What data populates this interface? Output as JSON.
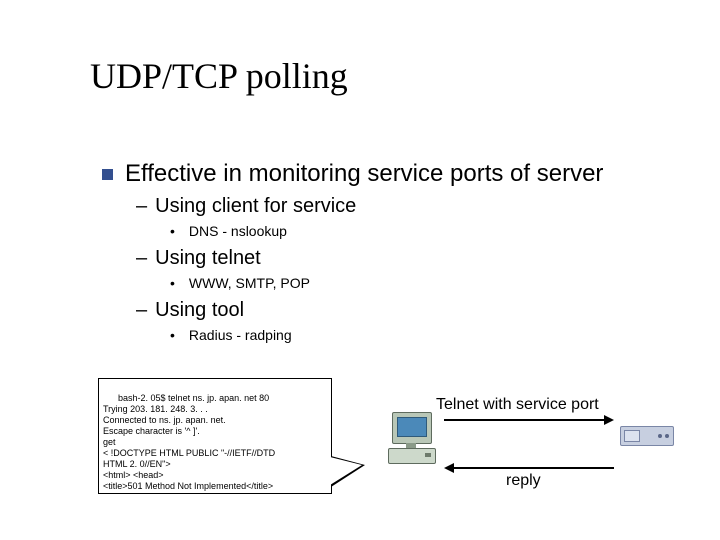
{
  "title": "UDP/TCP polling",
  "bullets": {
    "lvl1": "Effective in monitoring service ports of server",
    "sub1": {
      "label": "Using client for service",
      "ex": "DNS - nslookup"
    },
    "sub2": {
      "label": "Using telnet",
      "ex": "WWW, SMTP, POP"
    },
    "sub3": {
      "label": "Using tool",
      "ex": "Radius - radping"
    }
  },
  "terminal": {
    "lines": "bash-2. 05$ telnet ns. jp. apan. net 80\nTrying 203. 181. 248. 3. . .\nConnected to ns. jp. apan. net.\nEscape character is '^ ]'.\nget\n< !DOCTYPE HTML PUBLIC \"-//IETF//DTD\nHTML 2. 0//EN\">\n<html> <head>\n<title>501 Method Not Implemented</title>",
    "ellipsis": ":"
  },
  "diagram": {
    "top_label": "Telnet with service port",
    "bottom_label": "reply"
  }
}
